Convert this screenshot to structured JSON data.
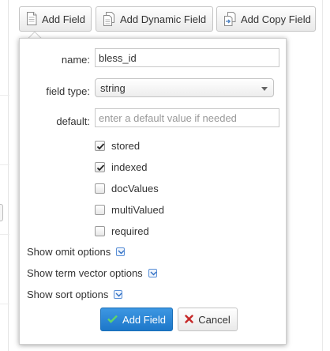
{
  "toolbar": {
    "add_field_label": "Add Field",
    "add_dynamic_field_label": "Add Dynamic Field",
    "add_copy_field_label": "Add Copy Field"
  },
  "form": {
    "name_label": "name:",
    "name_value": "bless_id",
    "field_type_label": "field type:",
    "field_type_value": "string",
    "default_label": "default:",
    "default_placeholder": "enter a default value if needed",
    "checkboxes": [
      {
        "label": "stored",
        "checked": true
      },
      {
        "label": "indexed",
        "checked": true
      },
      {
        "label": "docValues",
        "checked": false
      },
      {
        "label": "multiValued",
        "checked": false
      },
      {
        "label": "required",
        "checked": false
      }
    ],
    "show_omit_options": "Show omit options",
    "show_term_vector_options": "Show term vector options",
    "show_sort_options": "Show sort options",
    "submit_label": "Add Field",
    "cancel_label": "Cancel"
  },
  "colors": {
    "primary_button": "#1d77c9",
    "check_green": "#3fa34d",
    "cancel_red": "#c62828",
    "toggle_blue": "#5a8fd6"
  },
  "icons": {
    "add_field": "document-icon",
    "add_dynamic_field": "copy-documents-icon",
    "add_copy_field": "copy-arrow-icon",
    "submit": "checkmark-icon",
    "cancel": "x-icon",
    "expand": "chevron-down-icon"
  }
}
